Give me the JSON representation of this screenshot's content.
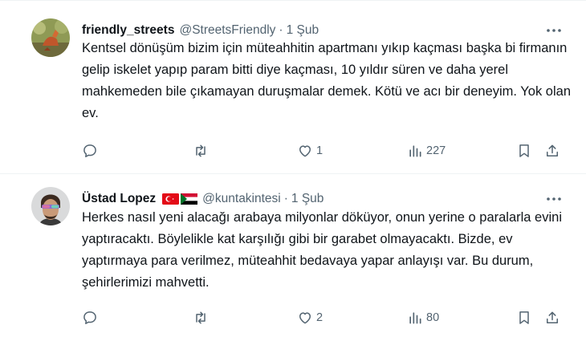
{
  "tweets": [
    {
      "display_name": "friendly_streets",
      "handle": "@StreetsFriendly",
      "separator": "·",
      "date": "1 Şub",
      "text": "Kentsel dönüşüm bizim için müteahhitin apartmanı yıkıp kaçması başka bi firmanın gelip iskelet yapıp param bitti diye kaçması, 10 yıldır süren ve daha yerel mahkemeden bile çıkamayan  duruşmalar demek. Kötü ve acı bir deneyim. Yok olan ev.",
      "replies": "",
      "retweets": "",
      "likes": "1",
      "views": "227"
    },
    {
      "display_name": "Üstad Lopez",
      "handle": "@kuntakintesi",
      "separator": "·",
      "date": "1 Şub",
      "text": "Herkes nasıl yeni alacağı arabaya milyonlar döküyor, onun yerine o paralarla evini yaptıracaktı. Böylelikle kat karşılığı gibi bir garabet olmayacaktı. Bizde, ev yaptırmaya para verilmez, müteahhit bedavaya yapar anlayışı var. Bu durum, şehirlerimizi mahvetti.",
      "replies": "",
      "retweets": "",
      "likes": "2",
      "views": "80"
    }
  ],
  "icons": {
    "more": "more-dots-icon",
    "reply": "reply-bubble-icon",
    "retweet": "retweet-arrows-icon",
    "like": "heart-icon",
    "views": "analytics-bars-icon",
    "bookmark": "bookmark-icon",
    "share": "share-upload-icon",
    "flag_1": "turkey-flag-icon",
    "flag_2": "sudan-flag-icon"
  },
  "colors": {
    "text": "#0f1419",
    "secondary": "#536471",
    "divider": "#eff3f4"
  }
}
